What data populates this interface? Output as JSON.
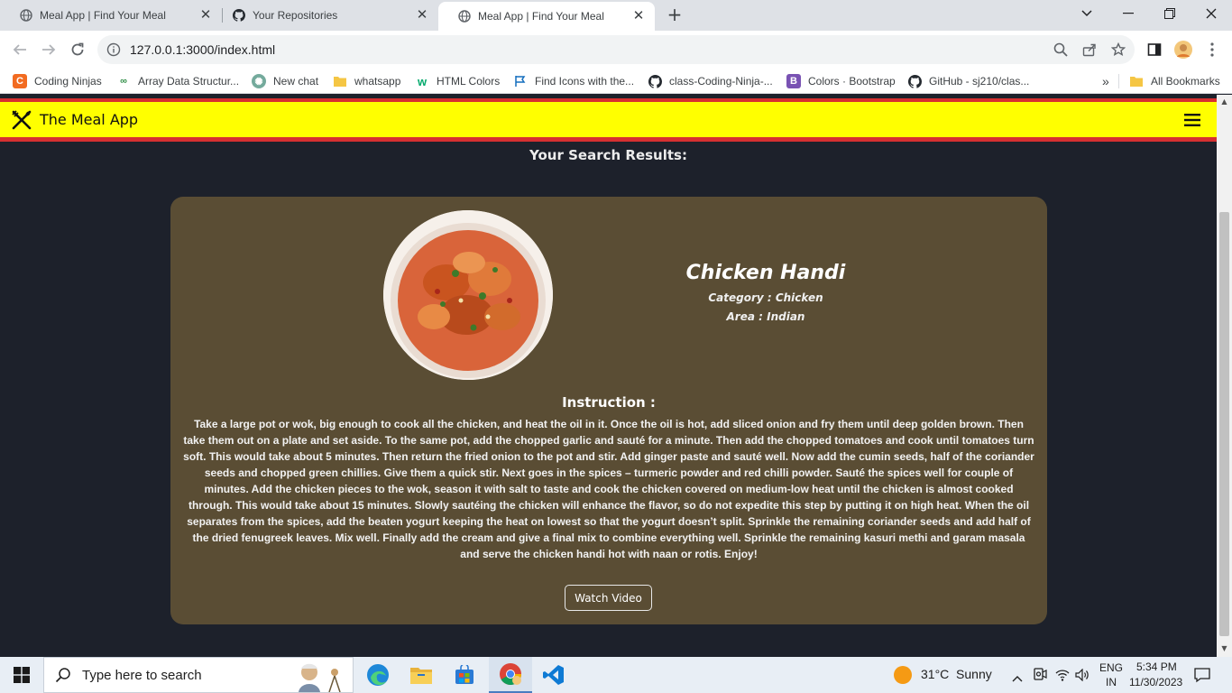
{
  "browser": {
    "tabs": [
      {
        "title": "Meal App | Find Your Meal",
        "icon": "globe-icon",
        "active": false
      },
      {
        "title": "Your Repositories",
        "icon": "github-icon",
        "active": false
      },
      {
        "title": "Meal App | Find Your Meal",
        "icon": "globe-icon",
        "active": true
      }
    ],
    "url": "127.0.0.1:3000/index.html",
    "bookmarks": [
      {
        "label": "Coding Ninjas",
        "icon": "coding-ninjas-icon",
        "color": "#f26b21"
      },
      {
        "label": "Array Data Structur...",
        "icon": "gfg-icon",
        "color": "#2f8d46"
      },
      {
        "label": "New chat",
        "icon": "chatgpt-icon",
        "color": "#74aa9c"
      },
      {
        "label": "whatsapp",
        "icon": "folder-icon",
        "color": "#f5c644"
      },
      {
        "label": "HTML Colors",
        "icon": "w3schools-icon",
        "color": "#04aa6d"
      },
      {
        "label": "Find Icons with the...",
        "icon": "fontawesome-flag-icon",
        "color": "#146ebe"
      },
      {
        "label": "class-Coding-Ninja-...",
        "icon": "github-icon",
        "color": "#24292f"
      },
      {
        "label": "Colors · Bootstrap",
        "icon": "bootstrap-icon",
        "color": "#7952b3"
      },
      {
        "label": "GitHub - sj210/clas...",
        "icon": "github-icon",
        "color": "#24292f"
      }
    ],
    "more_bookmarks": "»",
    "all_bookmarks": "All Bookmarks"
  },
  "app": {
    "brand": "The Meal App",
    "results_title": "Your Search Results:",
    "meal": {
      "name": "Chicken Handi",
      "category": "Category : Chicken",
      "area": "Area : Indian",
      "instruction_title": "Instruction :",
      "instructions": "Take a large pot or wok, big enough to cook all the chicken, and heat the oil in it. Once the oil is hot, add sliced onion and fry them until deep golden brown. Then take them out on a plate and set aside. To the same pot, add the chopped garlic and sauté for a minute. Then add the chopped tomatoes and cook until tomatoes turn soft. This would take about 5 minutes. Then return the fried onion to the pot and stir. Add ginger paste and sauté well. Now add the cumin seeds, half of the coriander seeds and chopped green chillies. Give them a quick stir. Next goes in the spices – turmeric powder and red chilli powder. Sauté the spices well for couple of minutes. Add the chicken pieces to the wok, season it with salt to taste and cook the chicken covered on medium-low heat until the chicken is almost cooked through. This would take about 15 minutes. Slowly sautéing the chicken will enhance the flavor, so do not expedite this step by putting it on high heat. When the oil separates from the spices, add the beaten yogurt keeping the heat on lowest so that the yogurt doesn’t split. Sprinkle the remaining coriander seeds and add half of the dried fenugreek leaves. Mix well. Finally add the cream and give a final mix to combine everything well. Sprinkle the remaining kasuri methi and garam masala and serve the chicken handi hot with naan or rotis. Enjoy!",
      "button": "Watch Video"
    },
    "colors": {
      "navbar": "#ffff00",
      "navbar_border": "#d63031",
      "background": "#1d212b",
      "card": "#5a4d34"
    }
  },
  "taskbar": {
    "search_placeholder": "Type here to search",
    "weather": "31°C  Sunny",
    "lang_top": "ENG",
    "lang_bottom": "IN",
    "time": "5:34 PM",
    "date": "11/30/2023"
  }
}
